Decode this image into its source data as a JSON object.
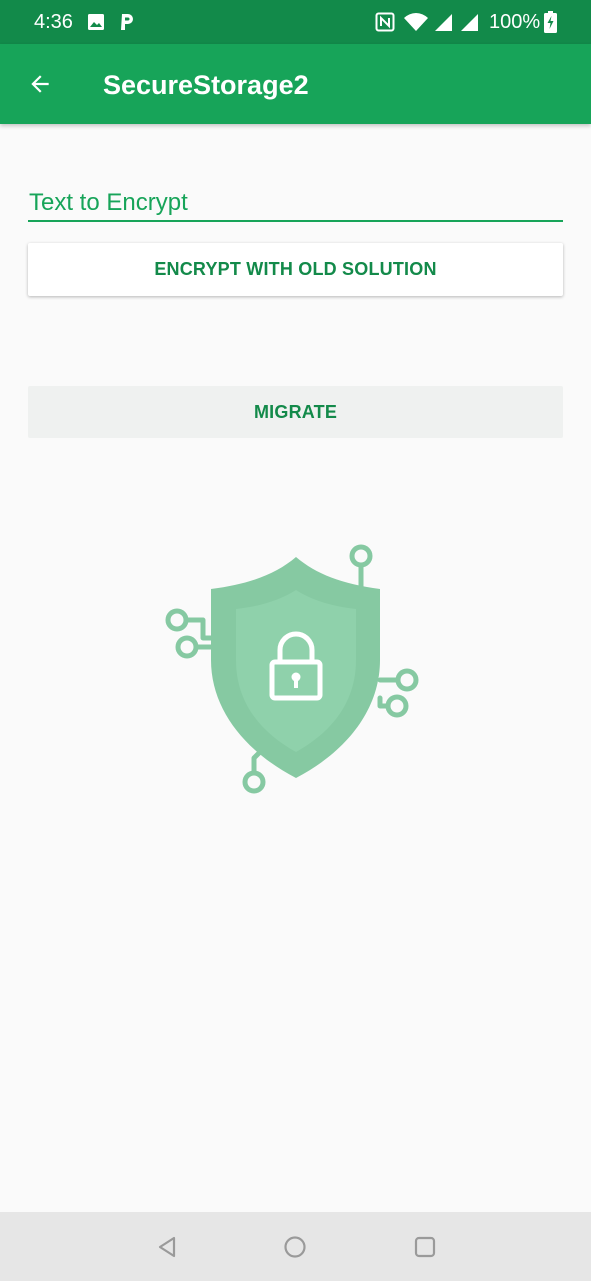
{
  "status_bar": {
    "time": "4:36",
    "battery": "100%",
    "icons": [
      "image-icon",
      "parking-icon",
      "nfc-icon",
      "wifi-icon",
      "signal-icon",
      "signal-icon",
      "battery-charging-icon"
    ]
  },
  "app_bar": {
    "title": "SecureStorage2",
    "back_icon": "arrow-left-icon"
  },
  "form": {
    "input_placeholder": "Text to Encrypt",
    "encrypt_label": "ENCRYPT WITH OLD SOLUTION",
    "migrate_label": "MIGRATE"
  },
  "illustration": {
    "icon": "shield-lock-circuit-icon"
  },
  "nav_bar": {
    "icons": [
      "back-triangle-icon",
      "home-circle-icon",
      "recents-square-icon"
    ]
  },
  "colors": {
    "status_bar": "#128a4a",
    "app_bar": "#17a459",
    "accent_text": "#138a4a",
    "background": "#fafafa",
    "shield_outer": "#86c9a2",
    "shield_inner": "#8fd1ab"
  }
}
